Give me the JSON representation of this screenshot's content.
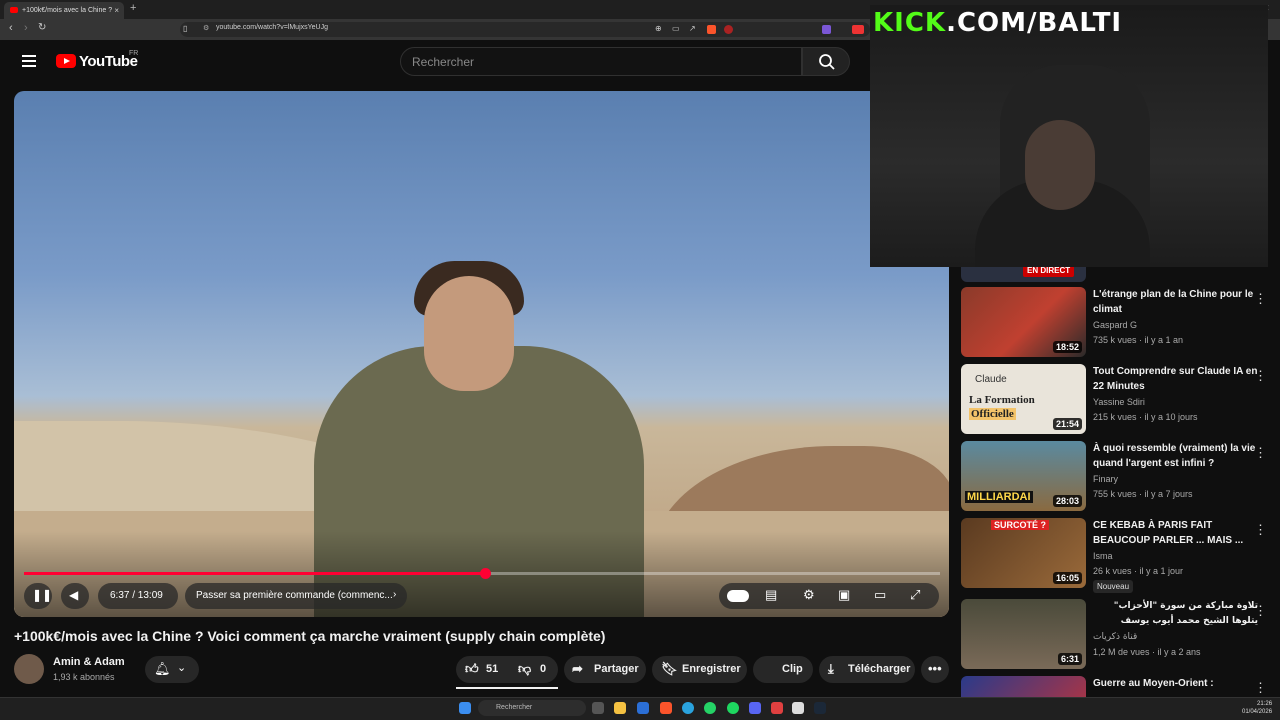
{
  "browser": {
    "tab_title": "+100k€/mois avec la Chine ?",
    "tab_close": "×",
    "new_tab": "+",
    "url": "youtube.com/watch?v=lMujxsYeUJg",
    "ext_badge": "1141"
  },
  "youtube": {
    "logo_text": "YouTube",
    "country": "FR",
    "search_placeholder": "Rechercher"
  },
  "video": {
    "current_time": "6:37",
    "duration": "13:09",
    "time_display": "6:37 / 13:09",
    "progress_fraction": 0.503,
    "chapter": "Passer sa première commande (commenc...",
    "title": "+100k€/mois avec la Chine ? Voici comment ça marche vraiment (supply chain complète)"
  },
  "channel": {
    "name": "Amin & Adam",
    "subscribers": "1,93 k abonnés"
  },
  "actions": {
    "likes": "51",
    "dislikes": "0",
    "share": "Partager",
    "save": "Enregistrer",
    "clip": "Clip",
    "download": "Télécharger"
  },
  "sidebar": {
    "live_badge": "EN DIRECT",
    "items": [
      {
        "title": "L'étrange plan de la Chine pour le climat",
        "channel": "Gaspard G",
        "meta": "735 k vues · il y a 1 an",
        "duration": "18:52",
        "thumb_color": "#8a3a2a"
      },
      {
        "title": "Tout Comprendre sur Claude IA en 22 Minutes",
        "channel": "Yassine Sdiri",
        "meta": "215 k vues · il y a 10 jours",
        "duration": "21:54",
        "thumb_color": "#e9e4da",
        "thumb_text1": "Claude",
        "thumb_text2": "La Formation",
        "thumb_text3": "Officielle"
      },
      {
        "title": "À quoi ressemble (vraiment) la vie quand l'argent est infini ?",
        "channel": "Finary",
        "meta": "755 k vues · il y a 7 jours",
        "duration": "28:03",
        "thumb_color": "#3a6a7a",
        "thumb_text1": "MILLIARDAI"
      },
      {
        "title": "CE KEBAB À PARIS FAIT BEAUCOUP PARLER ... MAIS ...",
        "channel": "Isma",
        "meta": "26 k vues · il y a 1 jour",
        "duration": "16:05",
        "badge": "Nouveau",
        "thumb_color": "#7a4a2a",
        "thumb_text1": "SURCOTÉ ?"
      },
      {
        "title": "تلاوة مباركة من سورة \"الأحزاب\" يتلوها الشيخ محمد أيوب يوسف",
        "channel": "قناة ذكريات",
        "meta": "1,2 M de vues · il y a 2 ans",
        "duration": "6:31",
        "thumb_color": "#6a5a48"
      },
      {
        "title": "Guerre au Moyen-Orient :",
        "channel": "",
        "meta": "",
        "duration": "",
        "thumb_color": "#3a4a8a"
      }
    ]
  },
  "overlay": {
    "kick_green": "KICK",
    "kick_white": ".COM/BALTI"
  },
  "taskbar": {
    "search": "Rechercher",
    "time": "21:26",
    "date": "01/04/2026"
  }
}
